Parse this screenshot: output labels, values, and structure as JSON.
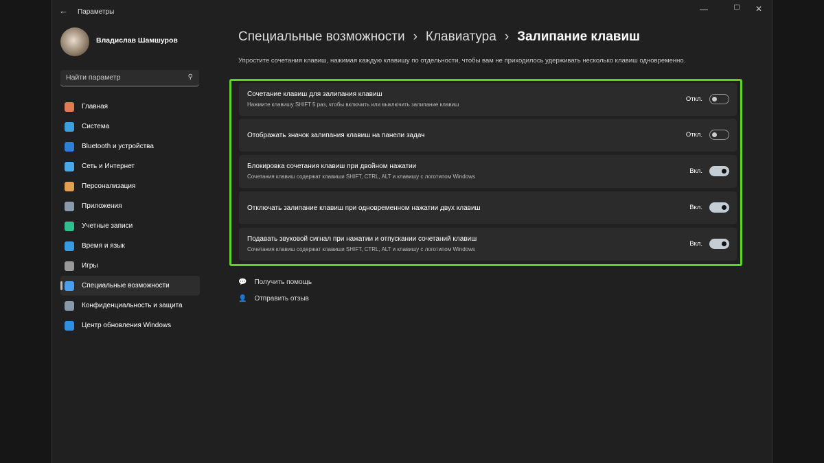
{
  "window": {
    "title": "Параметры",
    "minimize": "—",
    "maximize": "☐",
    "close": "✕",
    "back": "←"
  },
  "user": {
    "name": "Владислав Шамшуров"
  },
  "search": {
    "placeholder": "Найти параметр"
  },
  "nav": [
    {
      "label": "Главная",
      "color": "#e07b53"
    },
    {
      "label": "Система",
      "color": "#3aa0e0"
    },
    {
      "label": "Bluetooth и устройства",
      "color": "#2d7fd8"
    },
    {
      "label": "Сеть и Интернет",
      "color": "#4aa8e8"
    },
    {
      "label": "Персонализация",
      "color": "#e0a050"
    },
    {
      "label": "Приложения",
      "color": "#8a9aaa"
    },
    {
      "label": "Учетные записи",
      "color": "#2fbf8f"
    },
    {
      "label": "Время и язык",
      "color": "#3a9ae0"
    },
    {
      "label": "Игры",
      "color": "#999"
    },
    {
      "label": "Специальные возможности",
      "color": "#4aa0f0",
      "active": true
    },
    {
      "label": "Конфиденциальность и защита",
      "color": "#8899aa"
    },
    {
      "label": "Центр обновления Windows",
      "color": "#2f8fe0"
    }
  ],
  "breadcrumb": [
    "Специальные возможности",
    "Клавиатура",
    "Залипание клавиш"
  ],
  "breadcrumb_sep": "›",
  "description": "Упростите сочетания клавиш, нажимая каждую клавишу по отдельности, чтобы вам не приходилось удерживать несколько клавиш одновременно.",
  "settings": [
    {
      "title": "Сочетание клавиш для залипания клавиш",
      "subtitle": "Нажмите клавишу SHIFT 5 раз, чтобы включить или выключить залипание клавиш",
      "state": "Откл.",
      "on": false
    },
    {
      "title": "Отображать значок залипания клавиш на панели задач",
      "subtitle": "",
      "state": "Откл.",
      "on": false
    },
    {
      "title": "Блокировка сочетания клавиш при двойном нажатии",
      "subtitle": "Сочетания клавиш содержат клавиши SHIFT, CTRL, ALT и клавишу с логотипом Windows",
      "state": "Вкл.",
      "on": true
    },
    {
      "title": "Отключать залипание клавиш при одновременном нажатии двух клавиш",
      "subtitle": "",
      "state": "Вкл.",
      "on": true
    },
    {
      "title": "Подавать звуковой сигнал при нажатии и отпускании сочетаний клавиш",
      "subtitle": "Сочетания клавиш содержат клавиши SHIFT, CTRL, ALT и клавишу с логотипом Windows",
      "state": "Вкл.",
      "on": true
    }
  ],
  "links": {
    "help": "Получить помощь",
    "feedback": "Отправить отзыв"
  },
  "highlight_color": "#5fd61e"
}
